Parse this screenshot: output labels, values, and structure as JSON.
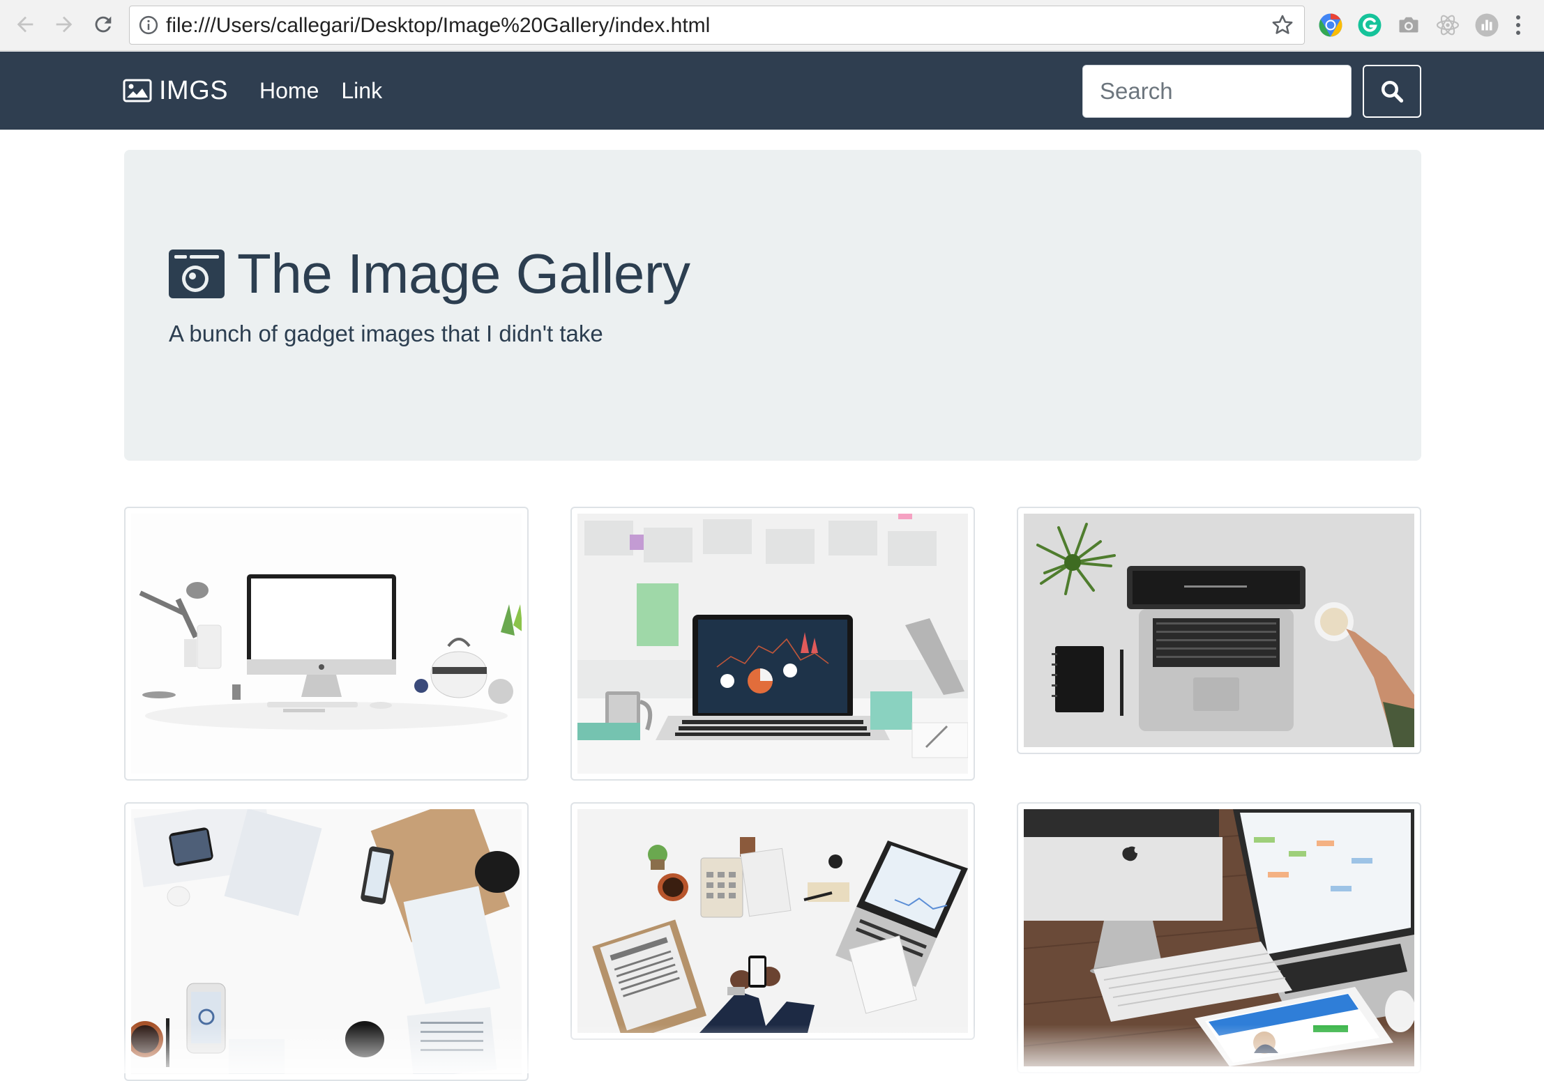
{
  "browser": {
    "url": "file:///Users/callegari/Desktop/Image%20Gallery/index.html",
    "icons": [
      "back-arrow-icon",
      "forward-arrow-icon",
      "reload-icon",
      "site-info-icon",
      "bookmark-star-icon"
    ],
    "extensions": [
      "chrome-extension-icon",
      "grammarly-icon",
      "camera-extension-icon",
      "react-devtools-icon",
      "analytics-extension-icon",
      "menu-kebab-icon"
    ]
  },
  "navbar": {
    "brand": "IMGS",
    "brand_icon": "image-icon",
    "links": [
      "Home",
      "Link"
    ],
    "search_placeholder": "Search",
    "search_icon": "search-icon",
    "background": "#2f3e50"
  },
  "hero": {
    "title": "The Image Gallery",
    "title_icon": "camera-icon",
    "lead": "A bunch of gadget images that I didn't take",
    "background": "#ecf0f1",
    "text_color": "#2c3e50"
  },
  "gallery": {
    "images": [
      {
        "subject": "white desk with iMac, lamp and kettle"
      },
      {
        "subject": "laptop with infographic screen on office desk"
      },
      {
        "subject": "laptop, plant, notebook and coffee cup from above"
      },
      {
        "subject": "phones and papers on white desk from above"
      },
      {
        "subject": "businessman desk with newspaper, calculator and laptop"
      },
      {
        "subject": "iMac, MacBook and iPad on wooden desk"
      }
    ]
  }
}
